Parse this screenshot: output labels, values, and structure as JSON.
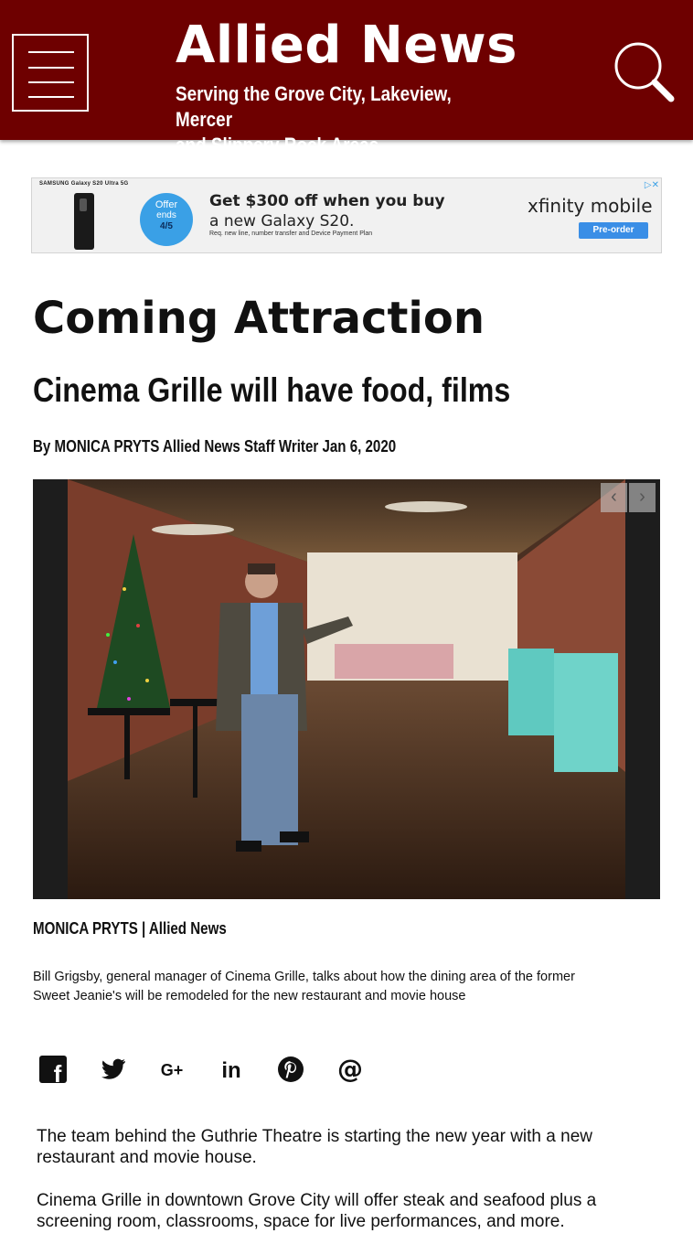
{
  "header": {
    "title": "Allied News",
    "subtitle_line1": "Serving the Grove City, Lakeview, Mercer",
    "subtitle_line2": "and Slippery Rock Areas",
    "menu_icon": "hamburger-icon",
    "search_icon": "search-icon",
    "color": "#6e0000"
  },
  "ad": {
    "brand": "SAMSUNG  Galaxy S20 Ultra 5G",
    "badge_line1": "Offer",
    "badge_line2": "ends",
    "badge_line3": "4/5",
    "headline_line1": "Get $300 off when you buy",
    "headline_line2": "a new Galaxy S20.",
    "fine_print": "Req. new line, number transfer and Device Payment Plan",
    "logo": "xfinity mobile",
    "cta": "Pre-order",
    "choices": "▷✕"
  },
  "article": {
    "title": "Coming Attraction",
    "subtitle": "Cinema Grille will have food, films",
    "byline": "By MONICA PRYTS Allied News Staff Writer Jan 6, 2020",
    "gallery_prev": "‹",
    "gallery_next": "›",
    "photo_credit": "MONICA PRYTS | Allied News",
    "caption": "Bill Grigsby, general manager of Cinema Grille, talks about how the dining area of the former Sweet Jeanie's will be remodeled for the new restaurant and movie house",
    "paragraphs": [
      "The team behind the Guthrie Theatre is starting the new year with a new restaurant and movie house.",
      "Cinema Grille in downtown Grove City will offer steak and seafood plus a screening room, classrooms, space for live performances, and more."
    ]
  },
  "share": {
    "facebook": "f",
    "google_plus": "G+",
    "linkedin": "in",
    "email": "@"
  }
}
